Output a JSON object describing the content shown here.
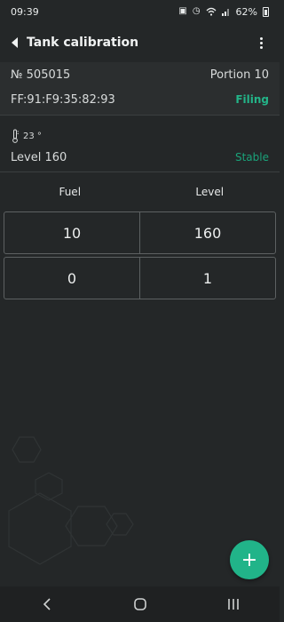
{
  "status_bar": {
    "time": "09:39",
    "battery": "62%"
  },
  "app_bar": {
    "title": "Tank calibration"
  },
  "device": {
    "number": "№ 505015",
    "portion": "Portion 10",
    "mac": "FF:91:F9:35:82:93",
    "mode": "Filing"
  },
  "sensor": {
    "temperature": "23 °",
    "level": "Level 160",
    "status": "Stable"
  },
  "table": {
    "headers": {
      "fuel": "Fuel",
      "level": "Level"
    },
    "rows": [
      {
        "fuel": "10",
        "level": "160"
      },
      {
        "fuel": "0",
        "level": "1"
      }
    ]
  },
  "fab": {
    "label": "+"
  },
  "colors": {
    "accent": "#21b489",
    "background": "#242728"
  }
}
